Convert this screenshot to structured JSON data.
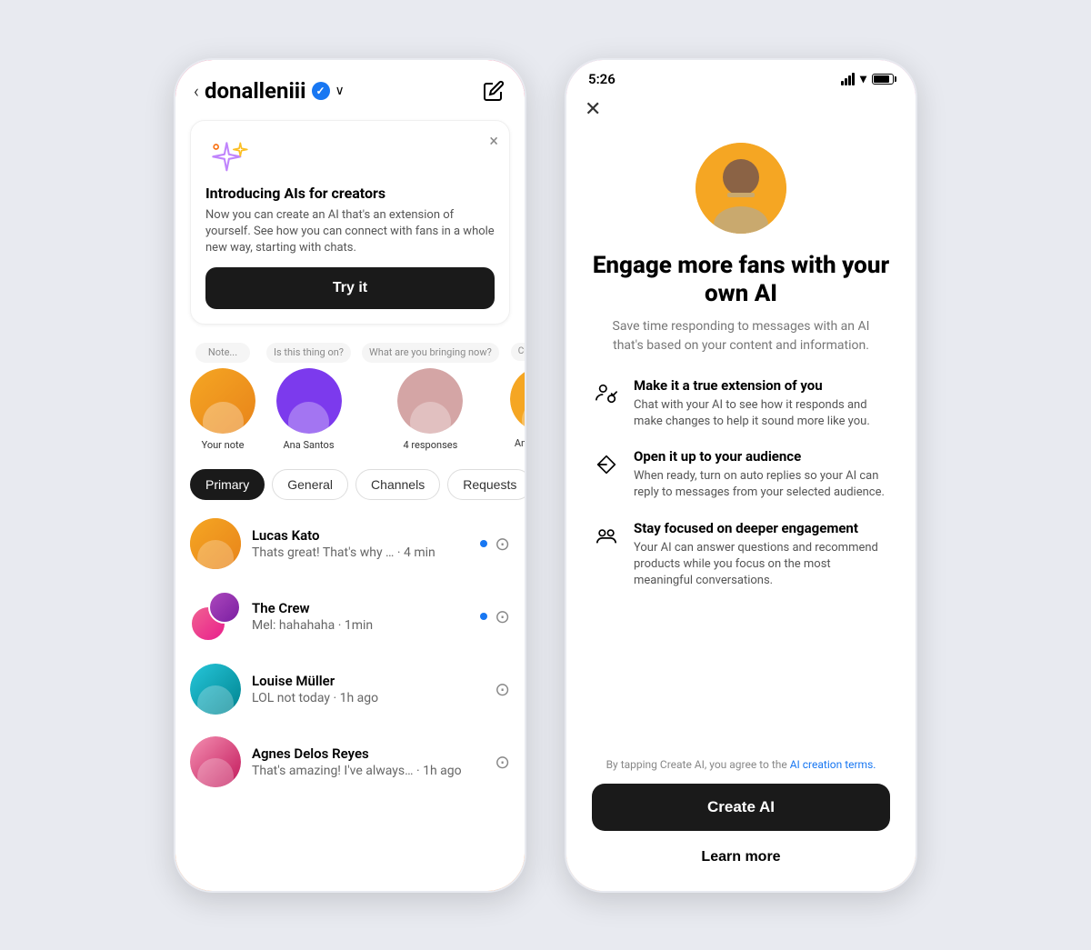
{
  "left_phone": {
    "header": {
      "back_label": "<",
      "username": "donalleniii",
      "verified": true,
      "compose_label": "compose"
    },
    "ai_banner": {
      "title": "Introducing AIs for creators",
      "description": "Now you can create an AI that's an extension of yourself. See how you can connect with fans in a whole new way, starting with chats.",
      "try_button": "Try it",
      "close_label": "×"
    },
    "stories": [
      {
        "note": "Note...",
        "label": "Your note",
        "type": "note"
      },
      {
        "note": "Is this thing on?",
        "label": "Ana Santos",
        "type": "story"
      },
      {
        "note": "What are you bringing now?",
        "label": "4 responses",
        "type": "story_group"
      },
      {
        "note": "Currently losing brain cells trying to",
        "label": "Ana Thomas",
        "type": "story"
      }
    ],
    "tabs": [
      {
        "label": "Primary",
        "active": true
      },
      {
        "label": "General",
        "active": false
      },
      {
        "label": "Channels",
        "active": false
      },
      {
        "label": "Requests",
        "active": false
      }
    ],
    "messages": [
      {
        "name": "Lucas Kato",
        "preview": "Thats great! That's why … · 4 min",
        "unread": true,
        "has_camera": true,
        "avatar_color": "av-orange"
      },
      {
        "name": "The Crew",
        "preview": "Mel: hahahaha · 1min",
        "unread": true,
        "has_camera": true,
        "avatar_color": "av-pink",
        "is_group": true
      },
      {
        "name": "Louise Müller",
        "preview": "LOL not today · 1h ago",
        "unread": false,
        "has_camera": true,
        "avatar_color": "av-teal"
      },
      {
        "name": "Agnes Delos Reyes",
        "preview": "That's amazing! I've always… · 1h ago",
        "unread": false,
        "has_camera": true,
        "avatar_color": "av-purple"
      }
    ]
  },
  "right_phone": {
    "status_bar": {
      "time": "5:26"
    },
    "header": {
      "close_label": "×"
    },
    "promo": {
      "title": "Engage more fans with your own AI",
      "subtitle": "Save time responding to messages with an AI that's based on your content and information.",
      "features": [
        {
          "icon": "person-ai-icon",
          "title": "Make it a true extension of you",
          "description": "Chat with your AI to see how it responds and make changes to help it sound more like you."
        },
        {
          "icon": "audience-icon",
          "title": "Open it up to your audience",
          "description": "When ready, turn on auto replies so your AI can reply to messages from your selected audience."
        },
        {
          "icon": "engagement-icon",
          "title": "Stay focused on deeper engagement",
          "description": "Your AI can answer questions and recommend products while you focus on the most meaningful conversations."
        }
      ],
      "terms_text": "By tapping Create AI, you agree to the",
      "terms_link": "AI creation terms.",
      "create_button": "Create AI",
      "learn_more_button": "Learn more"
    }
  }
}
